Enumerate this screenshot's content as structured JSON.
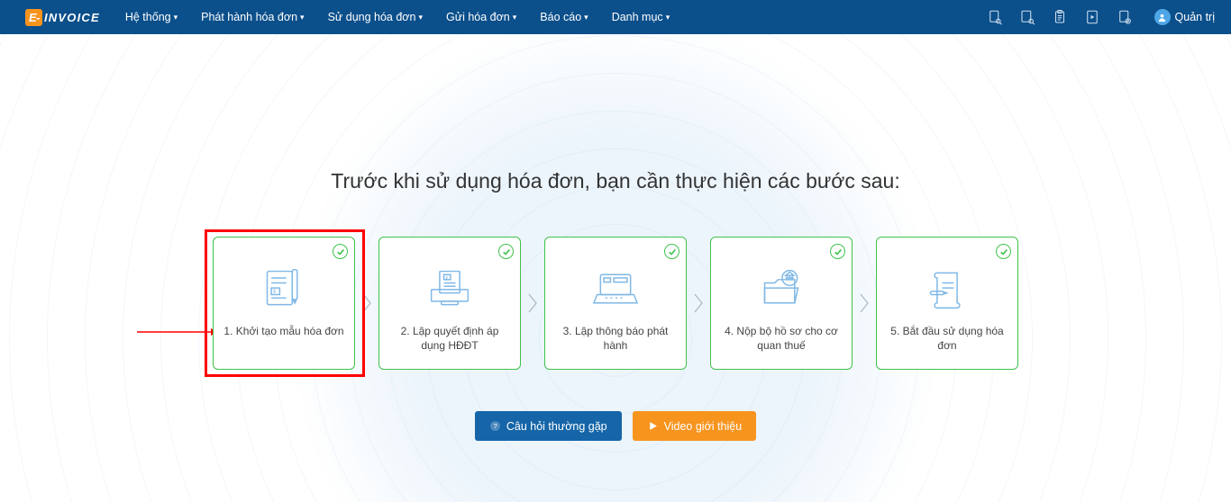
{
  "logo": {
    "prefix": "E-",
    "rest": "INVOICE"
  },
  "nav": {
    "items": [
      "Hệ thống",
      "Phát hành hóa đơn",
      "Sử dụng hóa đơn",
      "Gửi hóa đơn",
      "Báo cáo",
      "Danh mục"
    ]
  },
  "user": {
    "name": "Quản trị"
  },
  "headline": "Trước khi sử dụng hóa đơn, bạn cần thực hiện các bước sau:",
  "steps": [
    {
      "label": "1. Khởi tạo mẫu hóa đơn"
    },
    {
      "label": "2. Lập quyết định áp dụng HĐĐT"
    },
    {
      "label": "3. Lập thông báo phát hành"
    },
    {
      "label": "4. Nộp bộ hồ sơ cho cơ quan thuế"
    },
    {
      "label": "5. Bắt đầu sử dụng hóa đơn"
    }
  ],
  "buttons": {
    "faq": "Câu hỏi thường gặp",
    "video": "Video giới thiệu"
  }
}
